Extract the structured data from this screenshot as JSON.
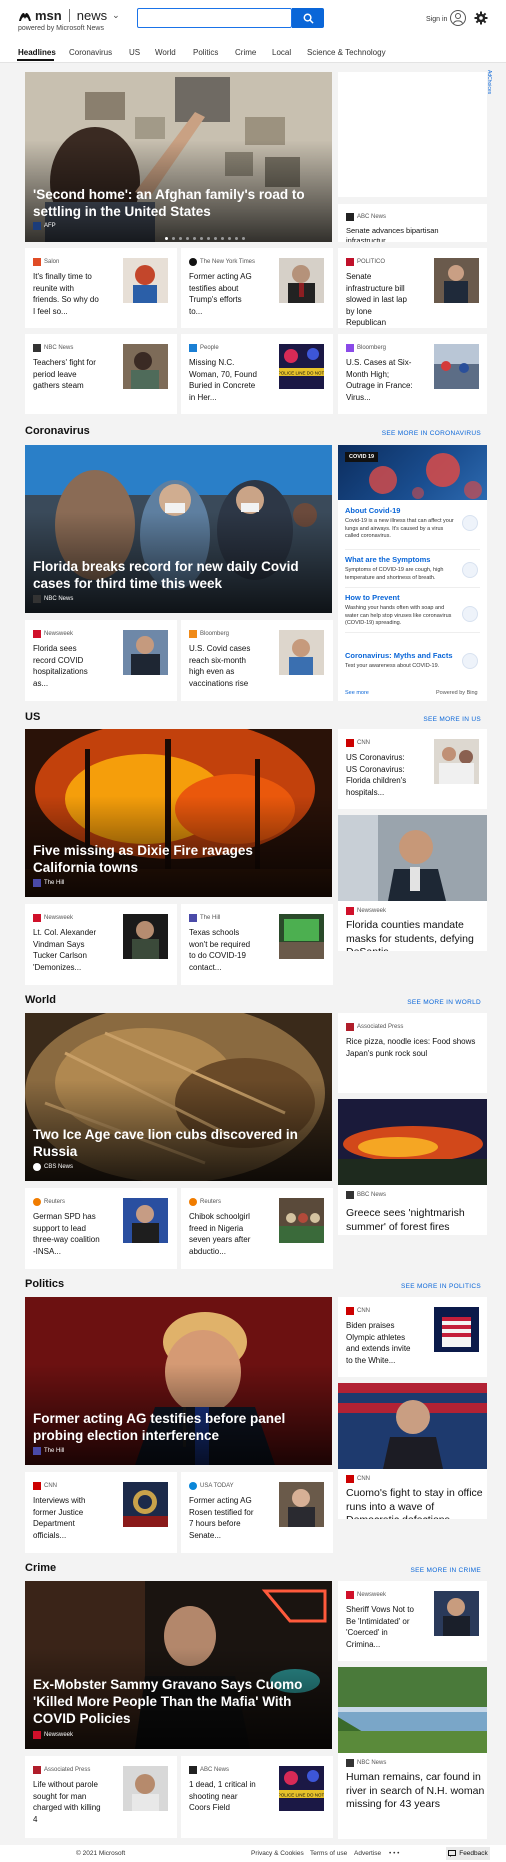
{
  "header": {
    "logo_text": "msn",
    "product": "news",
    "powered_by": "powered by Microsoft News",
    "search_placeholder": "",
    "signin": "Sign in"
  },
  "nav": [
    "Headlines",
    "Coronavirus",
    "US",
    "World",
    "Politics",
    "Crime",
    "Local",
    "Science & Technology"
  ],
  "adchoices": "AdChoices",
  "headlines": {
    "hero": {
      "title": "'Second home': an Afghan family's road to settling in the United States",
      "source": "AFP"
    },
    "side_strip": {
      "source": "ABC News",
      "title": "Senate advances bipartisan infrastructur..."
    },
    "cards": [
      {
        "source": "Salon",
        "title": "It's finally time to reunite with friends. So why do I feel so..."
      },
      {
        "source": "The New York Times",
        "title": "Former acting AG testifies about Trump's efforts to..."
      },
      {
        "source": "POLITICO",
        "title": "Senate infrastructure bill slowed in last lap by lone Republican"
      },
      {
        "source": "NBC News",
        "title": "Teachers' fight for period leave gathers steam"
      },
      {
        "source": "People",
        "title": "Missing N.C. Woman, 70, Found Buried in Concrete in Her..."
      },
      {
        "source": "Bloomberg",
        "title": "U.S. Cases at Six-Month High; Outrage in France: Virus..."
      }
    ]
  },
  "coronavirus": {
    "title": "Coronavirus",
    "see_more": "SEE MORE IN CORONAVIRUS",
    "hero": {
      "title": "Florida breaks record for new daily Covid cases for third time this week",
      "source": "NBC News"
    },
    "cards": [
      {
        "source": "Newsweek",
        "title": "Florida sees record COVID hospitalizations as..."
      },
      {
        "source": "Bloomberg",
        "title": "U.S. Covid cases reach six-month high even as vaccinations rise"
      }
    ],
    "panel": {
      "tag": "COVID 19",
      "items": [
        {
          "h": "About Covid-19",
          "p": "Covid-19 is a new illness that can affect your lungs and airways. It's caused by a virus called coronavirus."
        },
        {
          "h": "What are the Symptoms",
          "p": "Symptoms of COVID-19 are cough, high temperature and shortness of breath."
        },
        {
          "h": "How to Prevent",
          "p": "Washing your hands often with soap and water can help stop viruses like coronavirus (COVID-19) spreading."
        },
        {
          "h": "Coronavirus: Myths and Facts",
          "p": "Test your awareness about COVID-19."
        }
      ],
      "see_more": "See more",
      "powered": "Powered by Bing"
    }
  },
  "us": {
    "title": "US",
    "see_more": "SEE MORE IN US",
    "hero": {
      "title": "Five missing as Dixie Fire ravages California towns",
      "source": "The Hill"
    },
    "side_small": {
      "source": "CNN",
      "title": "US Coronavirus: US Coronavirus: Florida children's hospitals..."
    },
    "side_tall": {
      "source": "Newsweek",
      "title": "Florida counties mandate masks for students, defying DeSantis"
    },
    "cards": [
      {
        "source": "Newsweek",
        "title": "Lt. Col. Alexander Vindman Says Tucker Carlson 'Demonizes..."
      },
      {
        "source": "The Hill",
        "title": "Texas schools won't be required to do COVID-19 contact..."
      }
    ]
  },
  "world": {
    "title": "World",
    "see_more": "SEE MORE IN WORLD",
    "hero": {
      "title": "Two Ice Age cave lion cubs discovered in Russia",
      "source": "CBS News"
    },
    "side_small": {
      "source": "Associated Press",
      "title": "Rice pizza, noodle ices: Food shows Japan's punk rock soul"
    },
    "side_tall": {
      "source": "BBC News",
      "title": "Greece sees 'nightmarish summer' of forest fires"
    },
    "cards": [
      {
        "source": "Reuters",
        "title": "German SPD has support to lead three-way coalition -INSA..."
      },
      {
        "source": "Reuters",
        "title": "Chibok schoolgirl freed in Nigeria seven years after abductio..."
      }
    ]
  },
  "politics": {
    "title": "Politics",
    "see_more": "SEE MORE IN POLITICS",
    "hero": {
      "title": "Former acting AG testifies before panel probing election interference",
      "source": "The Hill"
    },
    "side_small": {
      "source": "CNN",
      "title": "Biden praises Olympic athletes and extends invite to the White..."
    },
    "side_tall": {
      "source": "CNN",
      "title": "Cuomo's fight to stay in office runs into a wave of Democratic defections"
    },
    "cards": [
      {
        "source": "CNN",
        "title": "Interviews with former Justice Department officials..."
      },
      {
        "source": "USA TODAY",
        "title": "Former acting AG Rosen testified for 7 hours before Senate..."
      }
    ]
  },
  "crime": {
    "title": "Crime",
    "see_more": "SEE MORE IN CRIME",
    "hero": {
      "title": "Ex-Mobster Sammy Gravano Says Cuomo 'Killed More People Than the Mafia' With COVID Policies",
      "source": "Newsweek"
    },
    "side_small": {
      "source": "Newsweek",
      "title": "Sheriff Vows Not to Be 'Intimidated' or 'Coerced' in Crimina..."
    },
    "side_tall": {
      "source": "NBC News",
      "title": "Human remains, car found in river in search of N.H. woman missing for 43 years"
    },
    "cards": [
      {
        "source": "Associated Press",
        "title": "Life without parole sought for man charged with killing 4"
      },
      {
        "source": "ABC News",
        "title": "1 dead, 1 critical in shooting near Coors Field"
      }
    ]
  },
  "footer": {
    "copyright": "© 2021 Microsoft",
    "privacy": "Privacy & Cookies",
    "terms": "Terms of use",
    "advertise": "Advertise",
    "more": "• • •",
    "feedback": "Feedback"
  }
}
